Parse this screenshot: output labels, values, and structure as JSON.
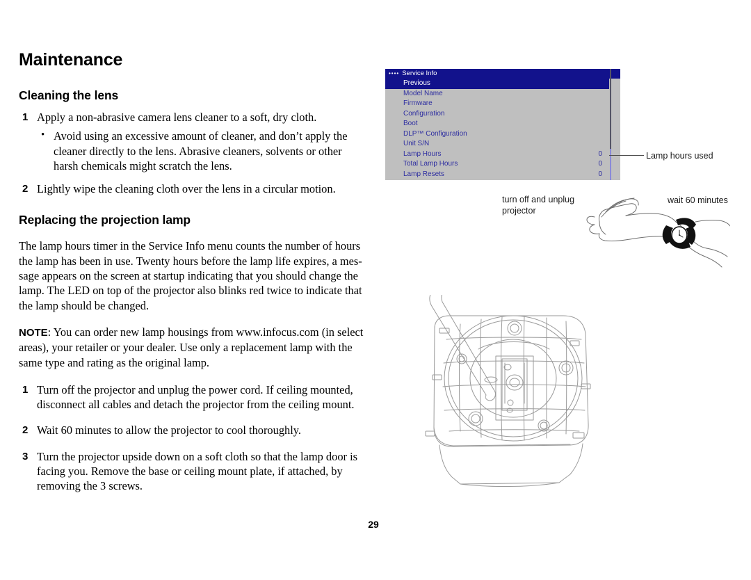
{
  "document": {
    "chapter_title": "Maintenance",
    "page_number": "29"
  },
  "sections": {
    "cleaning": {
      "heading": "Cleaning the lens",
      "step1_num": "1",
      "step1_text": "Apply a non-abrasive camera lens cleaner to a soft, dry cloth.",
      "bullet_dot": "•",
      "bullet1_text": "Avoid using an excessive amount of cleaner, and don’t apply the cleaner directly to the lens. Abrasive cleaners, solvents or other harsh chemicals might scratch the lens.",
      "step2_num": "2",
      "step2_text": "Lightly wipe the cleaning cloth over the lens in a circular motion."
    },
    "replacing": {
      "heading": "Replacing the projection lamp",
      "paragraph1": "The lamp hours timer in the Service Info menu counts the number of hours the lamp has been in use. Twenty hours before the lamp life expires, a mes-sage appears on the screen at startup indicating that you should change the lamp. The LED on top of the projector also blinks red twice to indicate that the lamp should be changed.",
      "note_label": "NOTE",
      "note_text": ": You can order new lamp housings from www.infocus.com (in select areas), your retailer or your dealer. Use only a replacement lamp with the same type and rating as the original lamp.",
      "step1_num": "1",
      "step1_text": "Turn off the projector and unplug the power cord. If ceiling mounted, disconnect all cables and detach the projector from the ceiling mount.",
      "step2_num": "2",
      "step2_text": "Wait 60 minutes to allow the projector to cool thoroughly.",
      "step3_num": "3",
      "step3_text": "Turn the projector upside down on a soft cloth so that the lamp door is facing you. Remove the base or ceiling mount plate, if attached, by removing the 3 screws."
    }
  },
  "osd_menu": {
    "dots": "••••",
    "title": "Service Info",
    "title_bg": "#12128c",
    "body_bg": "#bfbfbf",
    "item_color": "#2d2da0",
    "rows": [
      {
        "label": "Previous",
        "value": "",
        "selected": true
      },
      {
        "label": "Model Name",
        "value": "",
        "selected": false
      },
      {
        "label": "Firmware",
        "value": "",
        "selected": false
      },
      {
        "label": "Configuration",
        "value": "",
        "selected": false
      },
      {
        "label": "Boot",
        "value": "",
        "selected": false
      },
      {
        "label": "DLP™ Configuration",
        "value": "",
        "selected": false
      },
      {
        "label": "Unit S/N",
        "value": "",
        "selected": false
      },
      {
        "label": "Lamp Hours",
        "value": "0",
        "selected": false
      },
      {
        "label": "Total Lamp Hours",
        "value": "0",
        "selected": false
      },
      {
        "label": "Lamp Resets",
        "value": "0",
        "selected": false
      }
    ]
  },
  "annotations": {
    "lamp_hours_used": "Lamp hours used",
    "turn_off_unplug": "turn off and unplug projector",
    "wait_60_minutes": "wait 60 minutes"
  },
  "figures": {
    "hand_watch": "hand-with-wristwatch-illustration",
    "projector_bottom": "projector-underside-with-screwdriver-illustration"
  }
}
